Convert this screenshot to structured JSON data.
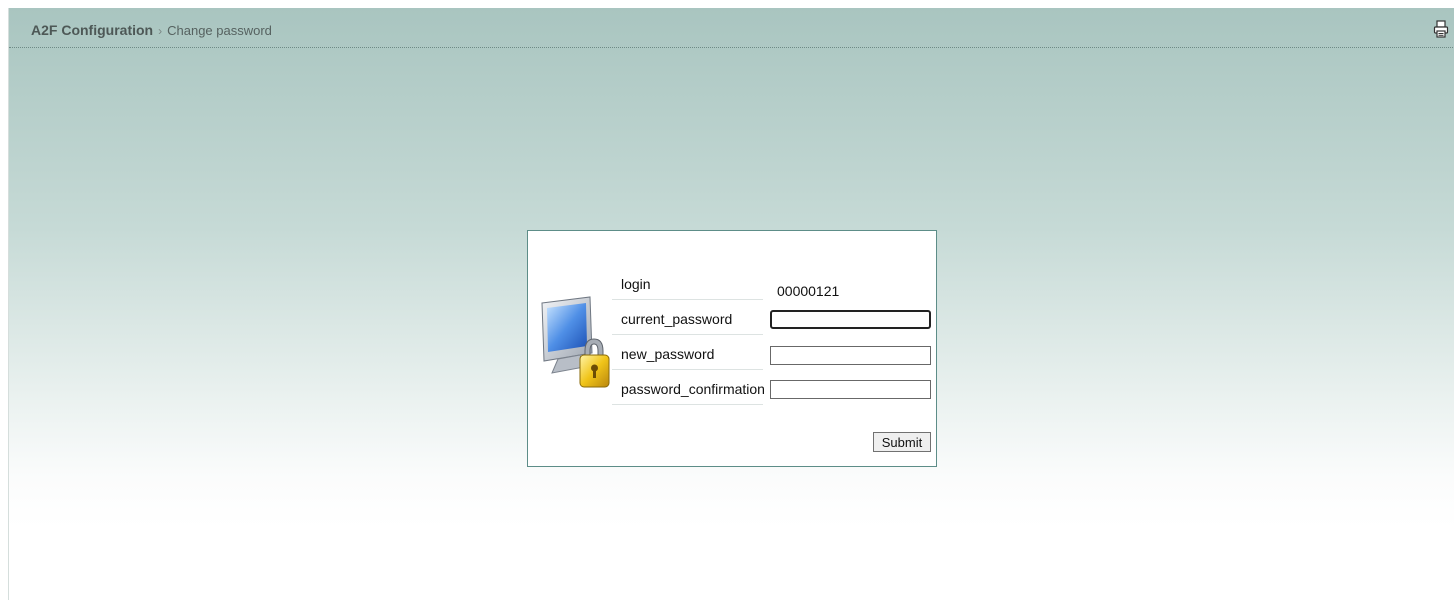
{
  "header": {
    "breadcrumb_root": "A2F Configuration",
    "breadcrumb_separator": "›",
    "breadcrumb_current": "Change password",
    "print_icon": "print-icon"
  },
  "form": {
    "icon": "computer-lock-icon",
    "fields": [
      {
        "label": "login",
        "value": "00000121"
      },
      {
        "label": "current_password",
        "value": ""
      },
      {
        "label": "new_password",
        "value": ""
      },
      {
        "label": "password_confirmation",
        "value": ""
      }
    ],
    "submit_label": "Submit"
  },
  "colors": {
    "background_top": "#a9c5c0",
    "dialog_border": "#5d8d88",
    "header_rule": "#6f8a86"
  }
}
